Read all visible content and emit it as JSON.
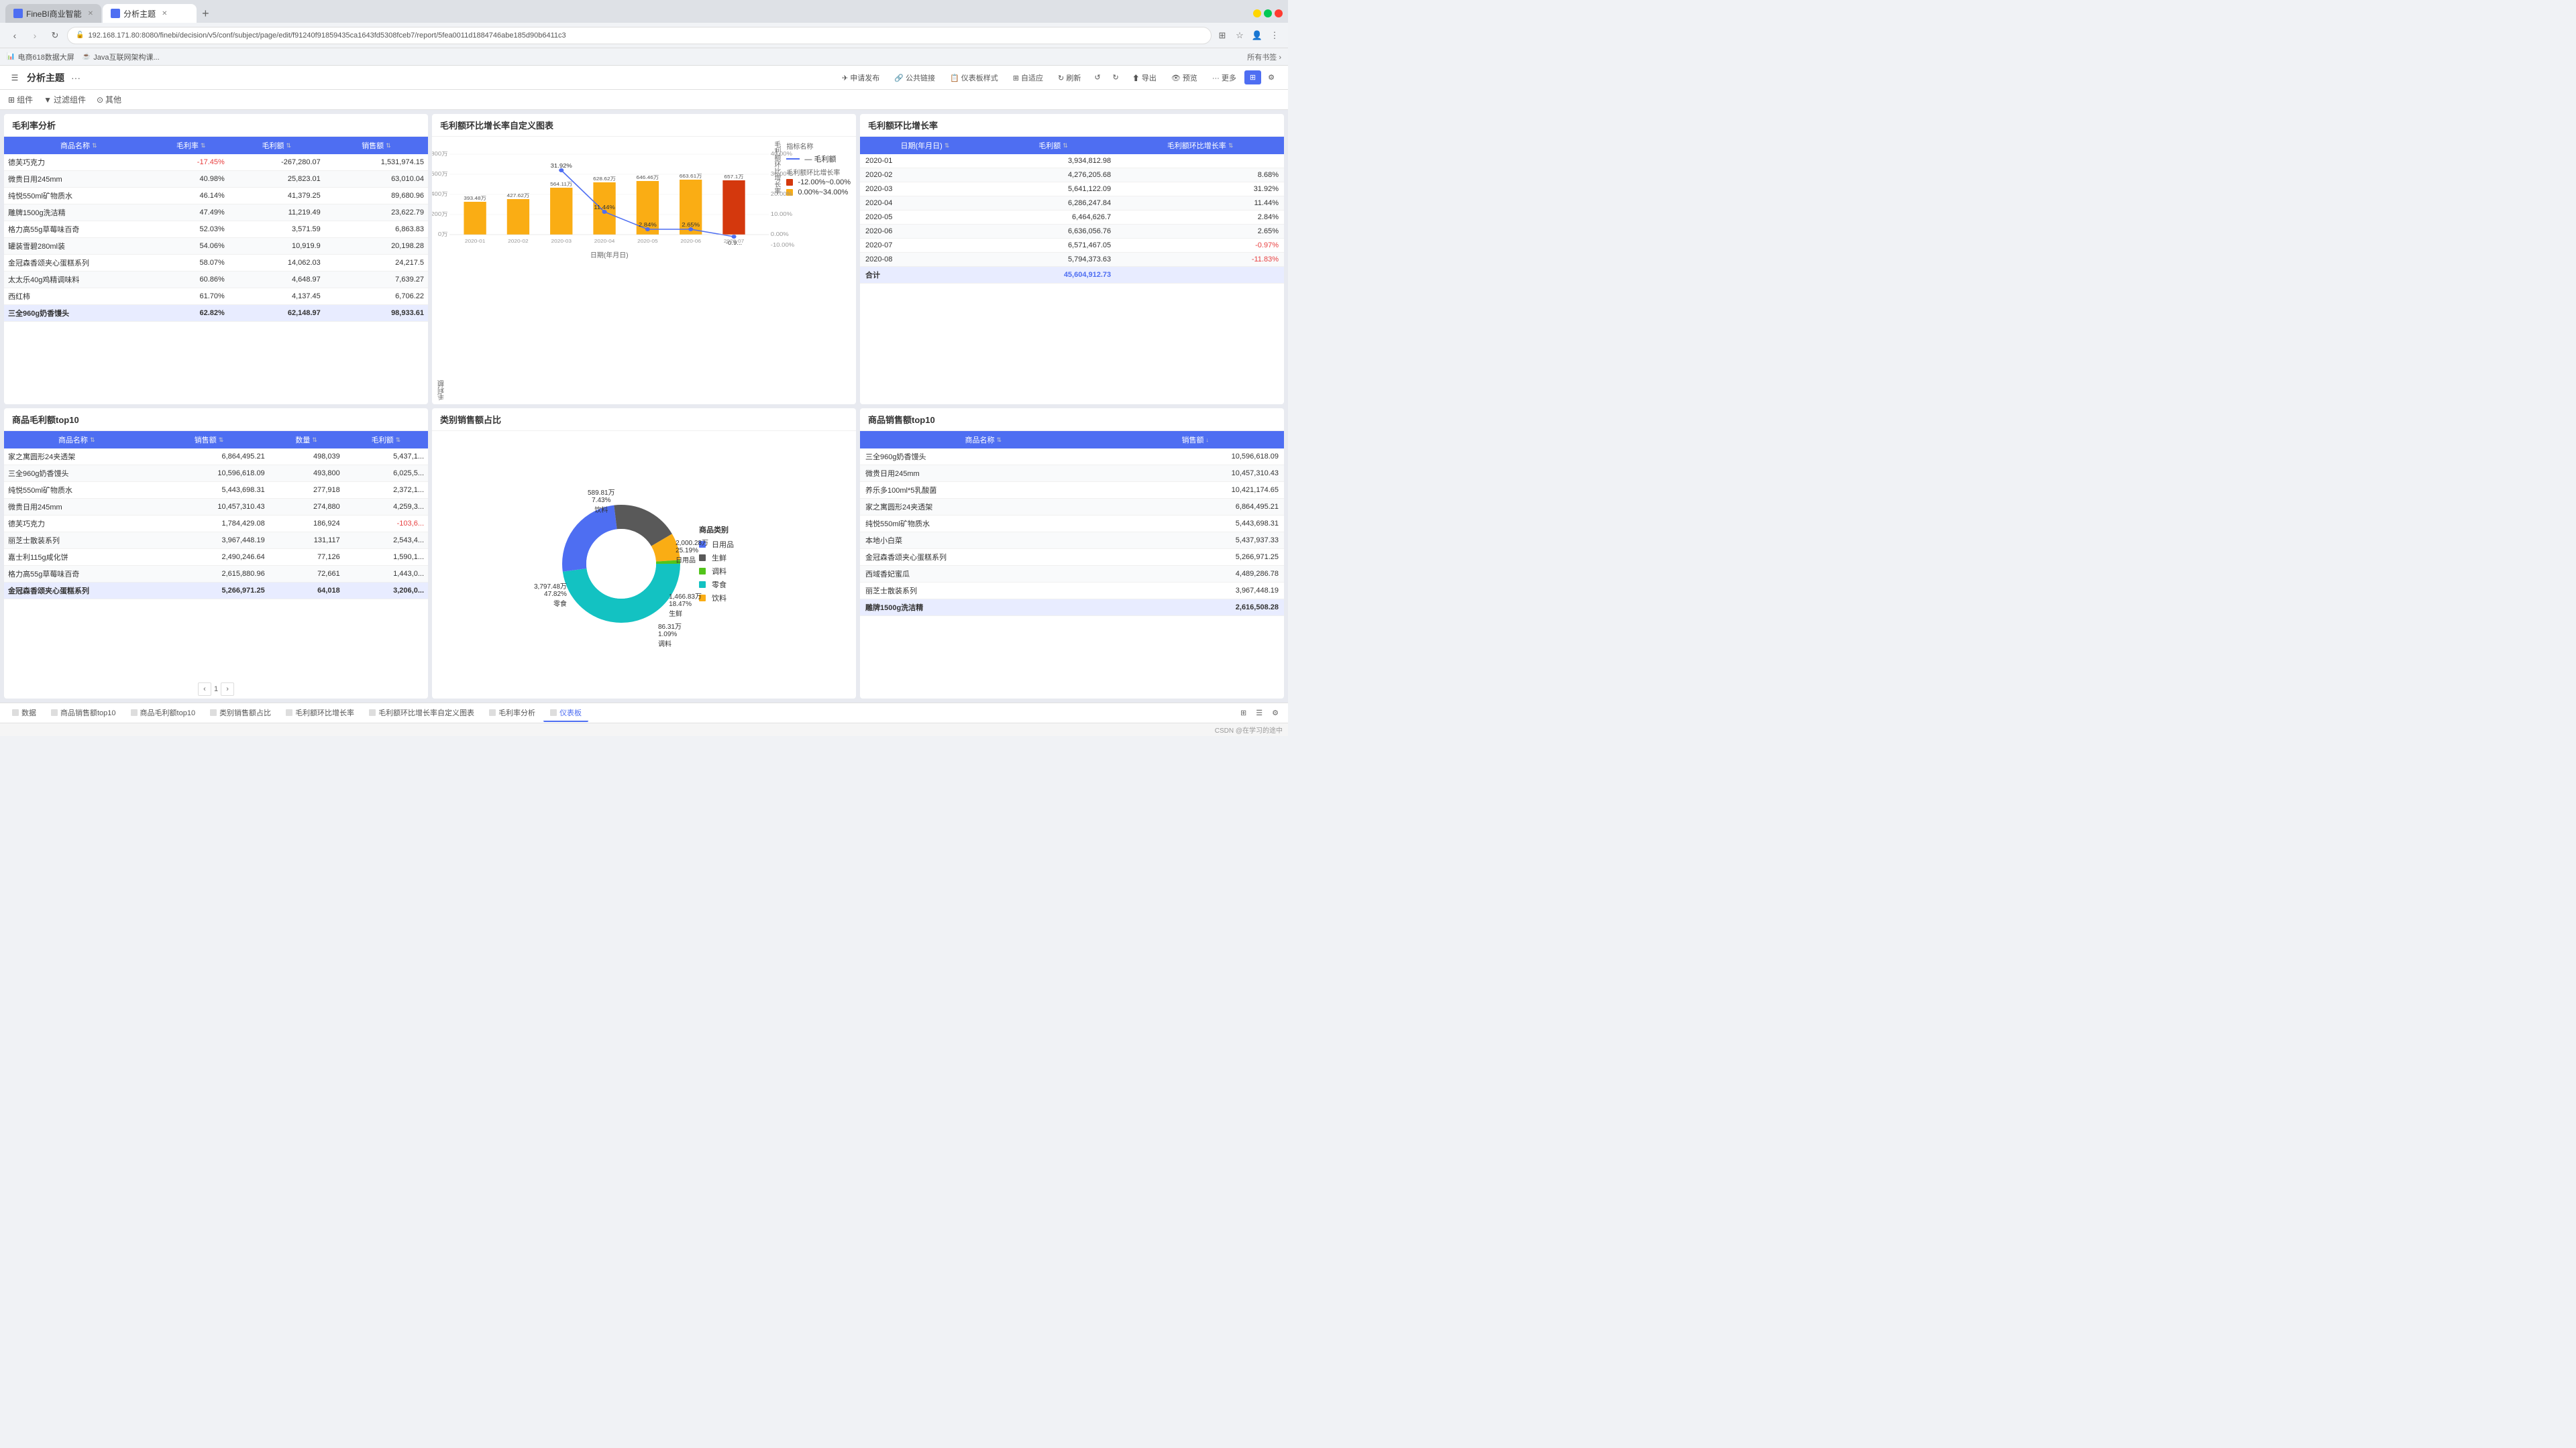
{
  "browser": {
    "tabs": [
      {
        "id": "tab1",
        "label": "FineBI商业智能",
        "active": false,
        "icon": "📊"
      },
      {
        "id": "tab2",
        "label": "分析主题",
        "active": true,
        "icon": "📋"
      }
    ],
    "url": "192.168.171.80:8080/finebi/decision/v5/conf/subject/page/edit/f91240f91859435ca1643fd5308fceb7/report/5fea0011d1884746abe185d90b6411c3",
    "bookmarks": [
      {
        "label": "电商618数据大屏"
      },
      {
        "label": "Java互联网架构课..."
      }
    ]
  },
  "toolbar": {
    "title": "分析主题",
    "more_icon": "···",
    "buttons": [
      {
        "label": "申请发布",
        "icon": "✈"
      },
      {
        "label": "公共链接",
        "icon": "🔗"
      },
      {
        "label": "仪表板样式",
        "icon": "📋"
      },
      {
        "label": "自适应",
        "icon": "⊞"
      },
      {
        "label": "刷新",
        "icon": "↻"
      },
      {
        "label": "撤销",
        "icon": "↺"
      },
      {
        "label": "恢复",
        "icon": "↻"
      },
      {
        "label": "导出",
        "icon": "⬆"
      },
      {
        "label": "预览",
        "icon": "👁"
      },
      {
        "label": "更多",
        "icon": "···"
      }
    ]
  },
  "subtoolbar": {
    "items": [
      {
        "label": "组件",
        "icon": "⊞"
      },
      {
        "label": "过滤组件",
        "icon": "▼"
      },
      {
        "label": "其他",
        "icon": "⊙"
      }
    ]
  },
  "panels": {
    "gross_margin_analysis": {
      "title": "毛利率分析",
      "columns": [
        "商品名称",
        "毛利率",
        "毛利额",
        "销售额"
      ],
      "rows": [
        {
          "name": "德芙巧克力",
          "margin_rate": "-17.45%",
          "margin": "-267,280.07",
          "sales": "1,531,974.15"
        },
        {
          "name": "微贵日用245mm",
          "margin_rate": "40.98%",
          "margin": "25,823.01",
          "sales": "63,010.04"
        },
        {
          "name": "纯悦550ml矿物质水",
          "margin_rate": "46.14%",
          "margin": "41,379.25",
          "sales": "89,680.96"
        },
        {
          "name": "雕牌1500g洗洁精",
          "margin_rate": "47.49%",
          "margin": "11,219.49",
          "sales": "23,622.79"
        },
        {
          "name": "格力高55g草莓味百奇",
          "margin_rate": "52.03%",
          "margin": "3,571.59",
          "sales": "6,863.83"
        },
        {
          "name": "罐装雪碧280ml装",
          "margin_rate": "54.06%",
          "margin": "10,919.9",
          "sales": "20,198.28"
        },
        {
          "name": "金冠森香颂夹心蛋糕系列",
          "margin_rate": "58.07%",
          "margin": "14,062.03",
          "sales": "24,217.5"
        },
        {
          "name": "太太乐40g鸡精调味料",
          "margin_rate": "60.86%",
          "margin": "4,648.97",
          "sales": "7,639.27"
        },
        {
          "name": "西红柿",
          "margin_rate": "61.70%",
          "margin": "4,137.45",
          "sales": "6,706.22"
        },
        {
          "name": "三全960g奶香馒头",
          "margin_rate": "62.82%",
          "margin": "62,148.97",
          "sales": "98,933.61"
        }
      ]
    },
    "gross_margin_trend": {
      "title": "毛利额环比增长率自定义图表",
      "legend": {
        "title": "指标名称",
        "items": [
          {
            "label": "— 毛利额",
            "color": "#4e6ef2"
          },
          {
            "label": "毛利额环比增长率",
            "color": ""
          },
          {
            "label": "-12.00%~0.00%",
            "color": "#d4380d"
          },
          {
            "label": "0.00%~34.00%",
            "color": "#faad14"
          }
        ]
      },
      "x_axis": [
        "2020-01",
        "2020-02",
        "2020-03",
        "2020-04",
        "2020-05",
        "2020-06",
        "2020-07"
      ],
      "y_axis_left_label": "毛利额",
      "y_axis_right_label": "毛利额环比增长率",
      "x_label": "日期(年月日)",
      "bars": [
        {
          "month": "2020-01",
          "value": 393.48,
          "rate": null,
          "color": "#faad14"
        },
        {
          "month": "2020-02",
          "value": 427.62,
          "rate": null,
          "color": "#faad14"
        },
        {
          "month": "2020-03",
          "value": 564.11,
          "rate": 31.92,
          "color": "#faad14"
        },
        {
          "month": "2020-04",
          "value": 628.62,
          "rate": 11.44,
          "color": "#faad14"
        },
        {
          "month": "2020-05",
          "value": 646.46,
          "rate": 2.84,
          "color": "#faad14"
        },
        {
          "month": "2020-06",
          "value": 663.61,
          "rate": 2.65,
          "color": "#faad14"
        },
        {
          "month": "2020-07",
          "value": 657,
          "rate": -0.9,
          "color": "#d4380d"
        }
      ],
      "rate_labels": [
        "31.92%",
        "",
        "11.44%",
        "2.84%",
        "2.65%",
        "-0.9..."
      ],
      "bar_labels": [
        "393.48万",
        "427.62万",
        "564.11万",
        "628.62万",
        "646.46万",
        "663.61万",
        "657.1万"
      ]
    },
    "gross_margin_rate": {
      "title": "毛利额环比增长率",
      "columns": [
        "日期(年月日)",
        "毛利额",
        "毛利额环比增长率"
      ],
      "rows": [
        {
          "date": "2020-01",
          "amount": "3,934,812.98",
          "rate": ""
        },
        {
          "date": "2020-02",
          "amount": "4,276,205.68",
          "rate": "8.68%"
        },
        {
          "date": "2020-03",
          "amount": "5,641,122.09",
          "rate": "31.92%"
        },
        {
          "date": "2020-04",
          "amount": "6,286,247.84",
          "rate": "11.44%"
        },
        {
          "date": "2020-05",
          "amount": "6,464,626.7",
          "rate": "2.84%"
        },
        {
          "date": "2020-06",
          "amount": "6,636,056.76",
          "rate": "2.65%"
        },
        {
          "date": "2020-07",
          "amount": "6,571,467.05",
          "rate": "-0.97%"
        },
        {
          "date": "2020-08",
          "amount": "5,794,373.63",
          "rate": "-11.83%"
        },
        {
          "date": "合计",
          "amount": "45,604,912.73",
          "rate": ""
        }
      ]
    },
    "top10_gross_profit": {
      "title": "商品毛利额top10",
      "columns": [
        "商品名称",
        "销售额",
        "数量",
        "毛利额"
      ],
      "rows": [
        {
          "name": "家之寓圆形24夹透架",
          "sales": "6,864,495.21",
          "qty": "498,039",
          "profit": "5,437,1..."
        },
        {
          "name": "三全960g奶香馒头",
          "sales": "10,596,618.09",
          "qty": "493,800",
          "profit": "6,025,5..."
        },
        {
          "name": "纯悦550ml矿物质水",
          "sales": "5,443,698.31",
          "qty": "277,918",
          "profit": "2,372,1..."
        },
        {
          "name": "微贵日用245mm",
          "sales": "10,457,310.43",
          "qty": "274,880",
          "profit": "4,259,3..."
        },
        {
          "name": "德芙巧克力",
          "sales": "1,784,429.08",
          "qty": "186,924",
          "profit": "-103,6..."
        },
        {
          "name": "丽芝士散装系列",
          "sales": "3,967,448.19",
          "qty": "131,117",
          "profit": "2,543,4..."
        },
        {
          "name": "嘉士利115g咸化饼",
          "sales": "2,490,246.64",
          "qty": "77,126",
          "profit": "1,590,1..."
        },
        {
          "name": "格力高55g草莓味百奇",
          "sales": "2,615,880.96",
          "qty": "72,661",
          "profit": "1,443,0..."
        },
        {
          "name": "金冠森香颂夹心蛋糕系列",
          "sales": "5,266,971.25",
          "qty": "64,018",
          "profit": "3,206,0..."
        }
      ]
    },
    "category_sales": {
      "title": "类别销售额占比",
      "legend": {
        "title": "商品类别",
        "items": [
          {
            "label": "日用品",
            "color": "#4e6ef2",
            "value": "589.81万",
            "pct": "7.43%",
            "sub": "饮料"
          },
          {
            "label": "生鲜",
            "color": "#2c2c2c"
          },
          {
            "label": "调料",
            "color": "#52c41a"
          },
          {
            "label": "零食",
            "color": "#13c2c2"
          },
          {
            "label": "饮料",
            "color": "#faad14"
          }
        ]
      },
      "segments": [
        {
          "label": "589.81万",
          "pct": "7.43%",
          "sub": "饮料",
          "color": "#faad14",
          "angle": 26
        },
        {
          "label": "2,000.28万",
          "pct": "25.19%",
          "sub": "日用品",
          "color": "#4e6ef2",
          "angle": 90
        },
        {
          "label": "1,466.83万",
          "pct": "18.47%",
          "sub": "生鲜",
          "color": "#595959",
          "angle": 66
        },
        {
          "label": "86.31万",
          "pct": "1.09%",
          "sub": "调料",
          "color": "#52c41a",
          "angle": 4
        },
        {
          "label": "3,797.48万",
          "pct": "47.82%",
          "sub": "零食",
          "color": "#13c2c2",
          "angle": 172
        }
      ]
    },
    "top10_sales": {
      "title": "商品销售额top10",
      "columns": [
        "商品名称",
        "销售额"
      ],
      "rows": [
        {
          "name": "三全960g奶香馒头",
          "sales": "10,596,618.09"
        },
        {
          "name": "微贵日用245mm",
          "sales": "10,457,310.43"
        },
        {
          "name": "养乐多100ml*5乳酸菌",
          "sales": "10,421,174.65"
        },
        {
          "name": "家之寓圆形24夹透架",
          "sales": "6,864,495.21"
        },
        {
          "name": "纯悦550ml矿物质水",
          "sales": "5,443,698.31"
        },
        {
          "name": "本地小白菜",
          "sales": "5,437,937.33"
        },
        {
          "name": "金冠森香颂夹心蛋糕系列",
          "sales": "5,266,971.25"
        },
        {
          "name": "西域香妃蜜瓜",
          "sales": "4,489,286.78"
        },
        {
          "name": "丽芝士散装系列",
          "sales": "3,967,448.19"
        },
        {
          "name": "雕牌1500g洗洁精",
          "sales": "2,616,508.28"
        }
      ]
    }
  },
  "bottom_tabs": [
    {
      "label": "数据",
      "active": false
    },
    {
      "label": "商品销售额top10",
      "active": false
    },
    {
      "label": "商品毛利额top10",
      "active": false
    },
    {
      "label": "类别销售额占比",
      "active": false
    },
    {
      "label": "毛利额环比增长率",
      "active": false
    },
    {
      "label": "毛利额环比增长率自定义图表",
      "active": false
    },
    {
      "label": "毛利率分析",
      "active": false
    },
    {
      "label": "仪表板",
      "active": true
    }
  ],
  "status_bar": {
    "right_text": "CSDN @在学习的途中"
  },
  "colors": {
    "primary": "#4e6ef2",
    "danger": "#e84040",
    "warning": "#faad14",
    "success": "#52c41a",
    "teal": "#13c2c2",
    "dark": "#595959",
    "header_bg": "#4e6ef2"
  }
}
